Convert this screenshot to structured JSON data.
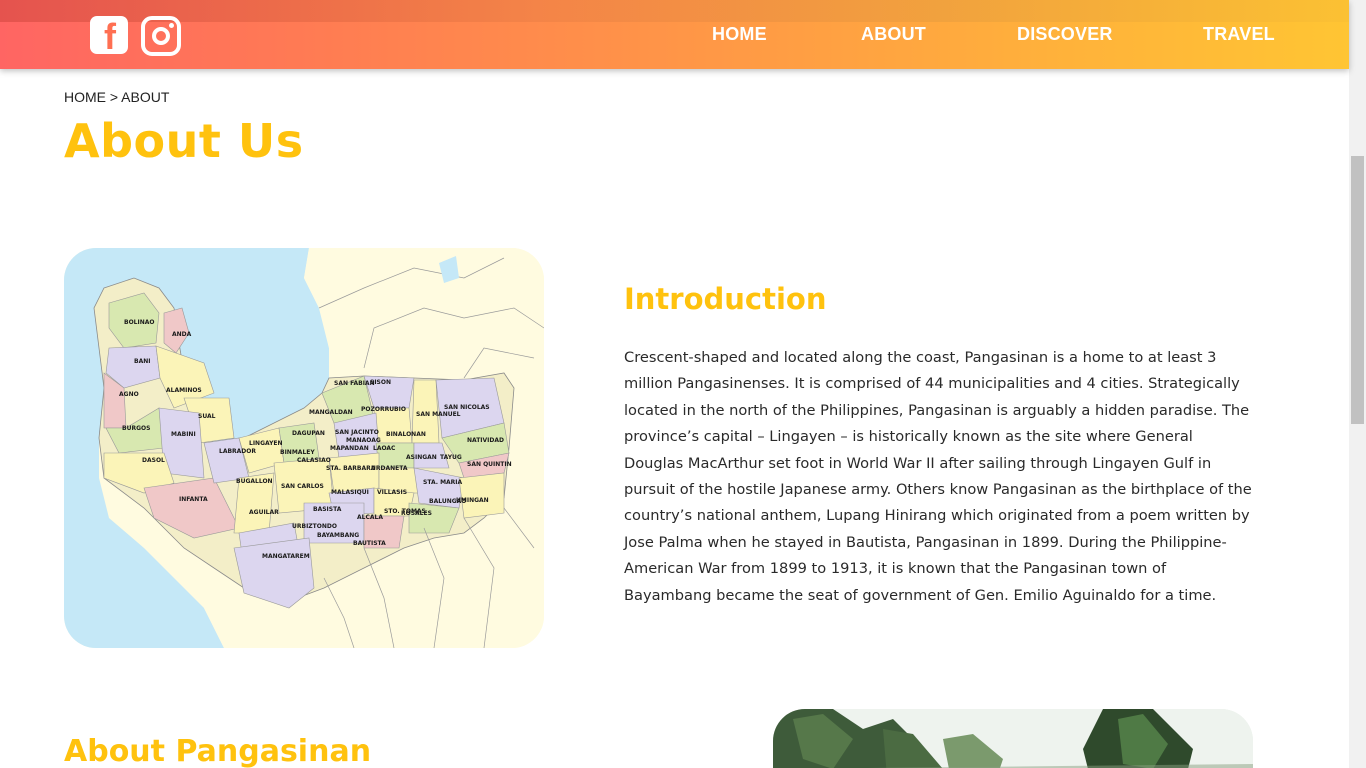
{
  "social": {
    "facebook_icon": "facebook-icon",
    "instagram_icon": "instagram-icon"
  },
  "nav": {
    "items": [
      {
        "label": "HOME"
      },
      {
        "label": "ABOUT"
      },
      {
        "label": "DISCOVER"
      },
      {
        "label": "TRAVEL"
      }
    ]
  },
  "breadcrumb": "HOME > ABOUT",
  "page_title": "About Us",
  "intro": {
    "heading": "Introduction",
    "body": "Crescent-shaped and located along the coast, Pangasinan is a home to at least 3 million Pangasinenses. It is comprised of 44 municipalities and 4 cities. Strategically located in the north of the Philippines, Pangasinan is arguably a hidden paradise. The province’s capital – Lingayen – is historically known as the site where General Douglas MacArthur set foot in World War II after sailing through Lingayen Gulf in pursuit of the hostile Japanese army. Others know Pangasinan as the birthplace of the country’s national anthem, Lupang Hinirang which originated from a poem written by Jose Palma when he stayed in Bautista, Pangasinan in 1899. During the Philippine-American War from 1899 to 1913, it is known that the Pangasinan town of Bayambang became the seat of government of Gen. Emilio Aguinaldo for a time."
  },
  "about_heading": "About Pangasinan",
  "map": {
    "labels": [
      "BOLINAO",
      "ANDA",
      "BANI",
      "ALAMINOS",
      "AGNO",
      "SUAL",
      "BURGOS",
      "MABINI",
      "DASOL",
      "INFANTA",
      "LABRADOR",
      "LINGAYEN",
      "BINMALEY",
      "DAGUPAN",
      "CALASIAO",
      "SAN FABIAN",
      "SISON",
      "MANGALDAN",
      "POZORRUBIO",
      "SAN MANUEL",
      "SAN NICOLAS",
      "SAN JACINTO",
      "MANAOAG",
      "BINALONAN",
      "NATIVIDAD",
      "MAPANDAN",
      "LAOAC",
      "STA. BARBARA",
      "URDANETA",
      "ASINGAN",
      "TAYUG",
      "SAN QUINTIN",
      "STA. MARIA",
      "BUGALLON",
      "SAN CARLOS",
      "MALASIQUI",
      "VILLASIS",
      "BALUNGAO",
      "UMINGAN",
      "AGUILAR",
      "BASISTA",
      "ALCALA",
      "STO. TOMAS",
      "ROSALES",
      "URBIZTONDO",
      "BAYAMBANG",
      "BAUTISTA",
      "MANGATAREM"
    ]
  },
  "colors": {
    "accent_yellow": "#ffc20e",
    "header_start": "#ff6563",
    "header_end": "#ffc533",
    "sea": "#c5e8f7",
    "land": "#fffbe0"
  }
}
